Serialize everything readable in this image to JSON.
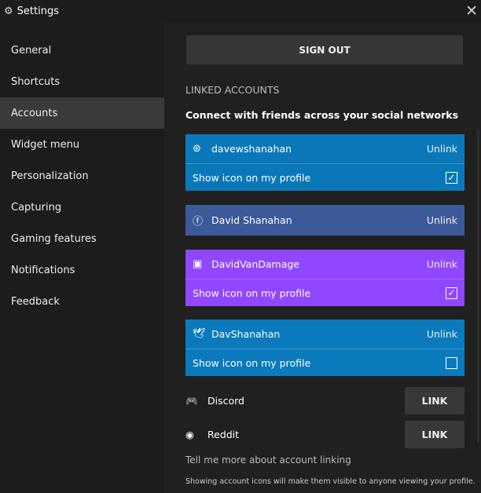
{
  "window": {
    "title": "Settings"
  },
  "sidebar": {
    "items": [
      {
        "label": "General"
      },
      {
        "label": "Shortcuts"
      },
      {
        "label": "Accounts",
        "selected": true
      },
      {
        "label": "Widget menu"
      },
      {
        "label": "Personalization"
      },
      {
        "label": "Capturing"
      },
      {
        "label": "Gaming features"
      },
      {
        "label": "Notifications"
      },
      {
        "label": "Feedback"
      }
    ]
  },
  "main": {
    "sign_out": "SIGN OUT",
    "section_title": "LINKED ACCOUNTS",
    "subheading": "Connect with friends across your social networks",
    "linked": [
      {
        "service": "steam",
        "name": "davewshanahan",
        "action": "Unlink",
        "color": "#0a78b8",
        "show_icon_label": "Show icon on my profile",
        "checked": true
      },
      {
        "service": "facebook",
        "name": "David Shanahan",
        "action": "Unlink",
        "color": "#3c5a99"
      },
      {
        "service": "twitch",
        "name": "DavidVanDamage",
        "action": "Unlink",
        "color": "#9146ff",
        "show_icon_label": "Show icon on my profile",
        "checked": true
      },
      {
        "service": "twitter",
        "name": "DavShanahan",
        "action": "Unlink",
        "color": "#0a7abc",
        "show_icon_label": "Show icon on my profile",
        "checked": false
      }
    ],
    "unlinked": [
      {
        "service": "discord",
        "name": "Discord",
        "action": "LINK"
      },
      {
        "service": "reddit",
        "name": "Reddit",
        "action": "LINK"
      }
    ],
    "more_link": "Tell me more about account linking",
    "note": "Showing account icons will make them visible to anyone viewing your profile."
  }
}
